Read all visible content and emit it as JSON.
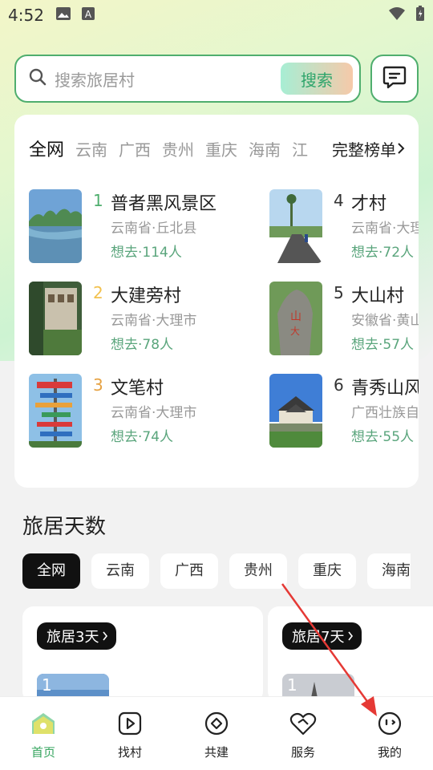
{
  "status_bar": {
    "time": "4:52",
    "icons": [
      "image-icon",
      "a-icon",
      "wifi-icon",
      "battery-icon"
    ]
  },
  "search": {
    "placeholder": "搜索旅居村",
    "button_label": "搜索"
  },
  "ranking": {
    "regions": [
      "全网",
      "云南",
      "广西",
      "贵州",
      "重庆",
      "海南",
      "江"
    ],
    "active_region": "全网",
    "full_list_label": "完整榜单",
    "items": [
      {
        "rank": "1",
        "name": "普者黑风景区",
        "place": "云南省·丘北县",
        "want": "想去·114人",
        "rank_color": "#4fae6e"
      },
      {
        "rank": "2",
        "name": "大建旁村",
        "place": "云南省·大理市",
        "want": "想去·78人",
        "rank_color": "#f2c14e"
      },
      {
        "rank": "3",
        "name": "文笔村",
        "place": "云南省·大理市",
        "want": "想去·74人",
        "rank_color": "#e6a243"
      },
      {
        "rank": "4",
        "name": "才村",
        "place": "云南省·大理市",
        "want": "想去·72人",
        "rank_color": "#333333"
      },
      {
        "rank": "5",
        "name": "大山村",
        "place": "安徽省·黄山市",
        "want": "想去·57人",
        "rank_color": "#333333"
      },
      {
        "rank": "6",
        "name": "青秀山风景区",
        "place": "广西壮族自治区",
        "want": "想去·55人",
        "rank_color": "#333333"
      }
    ]
  },
  "days_section": {
    "title": "旅居天数",
    "tabs": [
      "全网",
      "云南",
      "广西",
      "贵州",
      "重庆",
      "海南"
    ],
    "active_tab": "全网",
    "cards": [
      {
        "badge": "旅居3天",
        "thumb_rank": "1"
      },
      {
        "badge": "旅居7天",
        "thumb_rank": "1"
      }
    ]
  },
  "bottom_nav": [
    {
      "label": "首页",
      "icon": "home-icon",
      "active": true
    },
    {
      "label": "找村",
      "icon": "play-square-icon",
      "active": false
    },
    {
      "label": "共建",
      "icon": "diamond-circle-icon",
      "active": false
    },
    {
      "label": "服务",
      "icon": "heart-handshake-icon",
      "active": false
    },
    {
      "label": "我的",
      "icon": "face-icon",
      "active": false
    }
  ],
  "colors": {
    "accent": "#36a55f",
    "annotation_arrow": "#e53935"
  }
}
